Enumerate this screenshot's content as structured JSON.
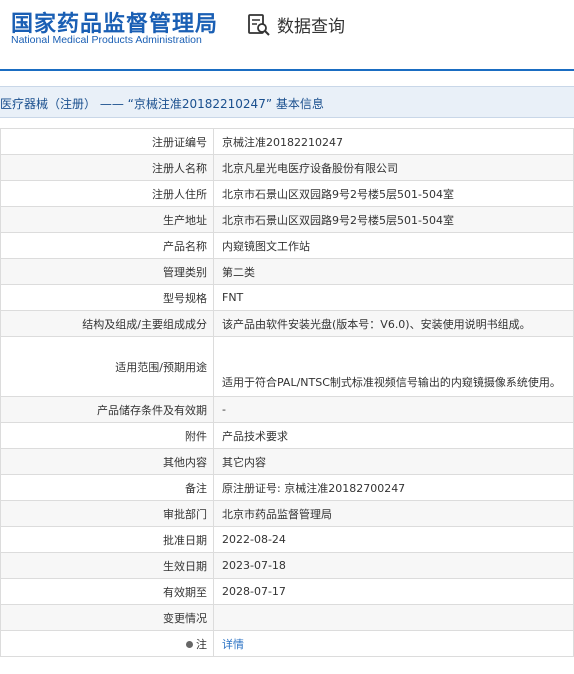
{
  "header": {
    "logo_cn": "国家药品监督管理局",
    "logo_en": "National Medical Products Administration",
    "query_label": "数据查询"
  },
  "section": {
    "title": "医疗器械（注册） —— “京械注准20182210247” 基本信息"
  },
  "rows": [
    {
      "label": "注册证编号",
      "value": "京械注准20182210247"
    },
    {
      "label": "注册人名称",
      "value": "北京凡星光电医疗设备股份有限公司"
    },
    {
      "label": "注册人住所",
      "value": "北京市石景山区双园路9号2号楼5层501-504室"
    },
    {
      "label": "生产地址",
      "value": "北京市石景山区双园路9号2号楼5层501-504室"
    },
    {
      "label": "产品名称",
      "value": "内窥镜图文工作站"
    },
    {
      "label": "管理类别",
      "value": "第二类"
    },
    {
      "label": "型号规格",
      "value": "FNT"
    },
    {
      "label": "结构及组成/主要组成成分",
      "value": "该产品由软件安装光盘(版本号：V6.0)、安装使用说明书组成。"
    },
    {
      "label": "适用范围/预期用途",
      "value": "适用于符合PAL/NTSC制式标准视频信号输出的内窥镜摄像系统使用。"
    },
    {
      "label": "产品储存条件及有效期",
      "value": "-"
    },
    {
      "label": "附件",
      "value": "产品技术要求"
    },
    {
      "label": "其他内容",
      "value": "其它内容"
    },
    {
      "label": "备注",
      "value": "原注册证号: 京械注准20182700247"
    },
    {
      "label": "审批部门",
      "value": "北京市药品监督管理局"
    },
    {
      "label": "批准日期",
      "value": "2022-08-24"
    },
    {
      "label": "生效日期",
      "value": "2023-07-18"
    },
    {
      "label": "有效期至",
      "value": "2028-07-17"
    },
    {
      "label": "变更情况",
      "value": ""
    },
    {
      "label": "注",
      "value": "详情"
    }
  ],
  "icons": {
    "query_icon": "document-search-icon",
    "note_icon": "bullet-icon"
  },
  "colors": {
    "brand": "#1a5fb4",
    "accent_line": "#1a6dc2",
    "section_bg": "#e9f0f8",
    "link": "#2a72c4"
  }
}
